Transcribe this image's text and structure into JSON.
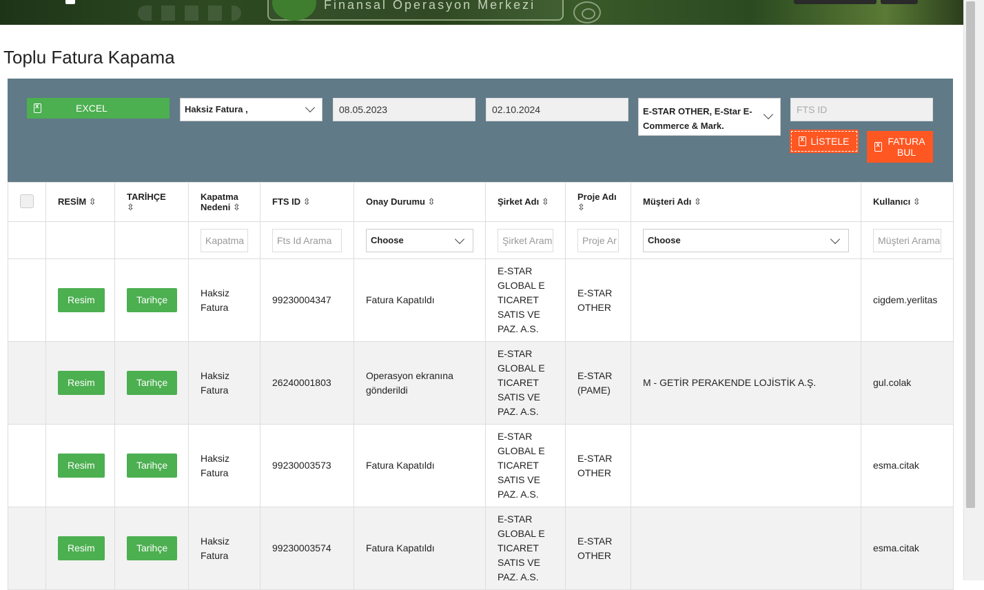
{
  "page": {
    "title": "Toplu Fatura Kapama"
  },
  "banner": {
    "subtitle": "Finansal Operasyon Merkezi"
  },
  "filters": {
    "excel_label": "EXCEL",
    "closing_reason": "Haksiz Fatura ,",
    "date_from": "08.05.2023",
    "date_to": "02.10.2024",
    "companies": "E-STAR OTHER, E-Star E-Commerce & Mark.",
    "fts_id_placeholder": "FTS ID",
    "listele_label": "LİSTELE",
    "fatura_bul_label_1": "FATURA",
    "fatura_bul_label_2": "BUL"
  },
  "table": {
    "headers": {
      "resim": "RESİM",
      "tarihce": "TARİHÇE",
      "kapatma_nedeni": "Kapatma Nedeni",
      "fts_id": "FTS ID",
      "onay_durumu": "Onay Durumu",
      "sirket_adi": "Şirket Adı",
      "proje_adi": "Proje Adı",
      "musteri_adi": "Müşteri Adı",
      "kullanici": "Kullanıcı"
    },
    "sort_glyph": "⇳",
    "search": {
      "kapatma": "Kapatma",
      "fts_id": "Fts Id Arama",
      "onay": "Choose",
      "sirket": "Şirket Aram",
      "proje": "Proje Ar",
      "musteri": "Choose",
      "kullanici": "Müşteri Arama"
    },
    "rows": [
      {
        "resim_btn": "Resim",
        "tarihce_btn": "Tarihçe",
        "kapatma_nedeni": "Haksiz Fatura",
        "fts_id": "99230004347",
        "onay_durumu": "Fatura Kapatıldı",
        "sirket_adi": "E-STAR GLOBAL E TICARET SATIS VE PAZ. A.S.",
        "proje_adi": "E-STAR OTHER",
        "musteri_adi": "",
        "kullanici": "cigdem.yerlitas"
      },
      {
        "resim_btn": "Resim",
        "tarihce_btn": "Tarihçe",
        "kapatma_nedeni": "Haksiz Fatura",
        "fts_id": "26240001803",
        "onay_durumu": "Operasyon ekranına gönderildi",
        "sirket_adi": "E-STAR GLOBAL E TICARET SATIS VE PAZ. A.S.",
        "proje_adi": "E-STAR (PAME)",
        "musteri_adi": "M - GETİR PERAKENDE LOJİSTİK A.Ş.",
        "kullanici": "gul.colak"
      },
      {
        "resim_btn": "Resim",
        "tarihce_btn": "Tarihçe",
        "kapatma_nedeni": "Haksiz Fatura",
        "fts_id": "99230003573",
        "onay_durumu": "Fatura Kapatıldı",
        "sirket_adi": "E-STAR GLOBAL E TICARET SATIS VE PAZ. A.S.",
        "proje_adi": "E-STAR OTHER",
        "musteri_adi": "",
        "kullanici": "esma.citak"
      },
      {
        "resim_btn": "Resim",
        "tarihce_btn": "Tarihçe",
        "kapatma_nedeni": "Haksiz Fatura",
        "fts_id": "99230003574",
        "onay_durumu": "Fatura Kapatıldı",
        "sirket_adi": "E-STAR GLOBAL E TICARET SATIS VE PAZ. A.S.",
        "proje_adi": "E-STAR OTHER",
        "musteri_adi": "",
        "kullanici": "esma.citak"
      }
    ]
  },
  "colors": {
    "filter_bar": "#607a87",
    "green": "#4caf50",
    "orange": "#ff5722"
  }
}
